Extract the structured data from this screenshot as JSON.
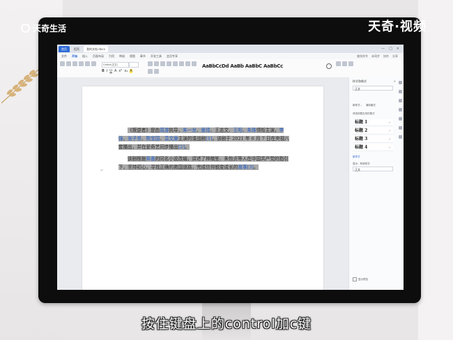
{
  "watermark": {
    "left": "天奇生活",
    "right": "天奇·视频"
  },
  "subtitle": "按住键盘上的control加c键",
  "window": {
    "tabs": [
      {
        "label": "首页"
      },
      {
        "label": "稻壳"
      },
      {
        "label": "我的文档.docx"
      }
    ],
    "controls": [
      "—",
      "□",
      "×"
    ]
  },
  "menu": {
    "items": [
      "文件",
      "开始",
      "插入",
      "页面布局",
      "引用",
      "审阅",
      "视图",
      "章节",
      "开发工具",
      "会员专享"
    ],
    "selected": "开始",
    "right": [
      "查找命令",
      "未同步",
      "协作",
      "分享"
    ]
  },
  "ribbon": {
    "font_name": "Calibri(正文)",
    "style_samples": "AaBbCcDd AaBb AaBbC AaBbCc",
    "format_buttons": [
      "B",
      "I",
      "U",
      "A",
      "x²",
      "x₂",
      "A"
    ]
  },
  "document": {
    "p1_start": "《叛逆者》是由",
    "p1_director": "周游",
    "p1_mid1": "执导，",
    "p1_actor1": "朱一龙",
    "p1_sep1": "、",
    "p1_actor2": "童瑶",
    "p1_sep2": "、王志文、",
    "p1_actor3": "王阳",
    "p1_sep3": "、",
    "p1_actor4": "朱珠",
    "p1_mid2": "领衔主演，",
    "p1_actor5": "李强",
    "p1_sep4": "、",
    "p1_actor6": "张子贤",
    "p1_sep5": "、",
    "p1_actor7": "陈宝国",
    "p1_sep6": "、",
    "p1_actor8": "袁文康",
    "p1_mid3": "主演的谍战剧",
    "p1_cite1": "[1]",
    "p1_mid4": "。该剧于 2021 年 6 月 7 日在央视八套播出，并在爱奇艺同步播出",
    "p1_cite2": "[2]",
    "p1_end": "。",
    "p2_start": "该剧根据",
    "p2_author": "畀愚",
    "p2_mid": "的同名小说改编，讲述了林楠笙、朱怡贞等人在中国共产党的指引下，坚持初心，寻找正确的救国道路，完成信仰蜕变成长的",
    "p2_link": "故事",
    "p2_cite": "[3]",
    "p2_end": "。",
    "cursor_mark": "↵"
  },
  "panel": {
    "title": "样式和格式",
    "close": "×",
    "dropdown1": "正文",
    "btn_new": "新样式...",
    "btn_clear": "清除格式",
    "sub_label": "请选择要应用的格式",
    "headings": [
      "标题 1",
      "标题 2",
      "标题 3",
      "标题 4"
    ],
    "more": "新样式",
    "show_label": "显示：有效样式",
    "dropdown2": "正文",
    "foot": "显示预览"
  }
}
